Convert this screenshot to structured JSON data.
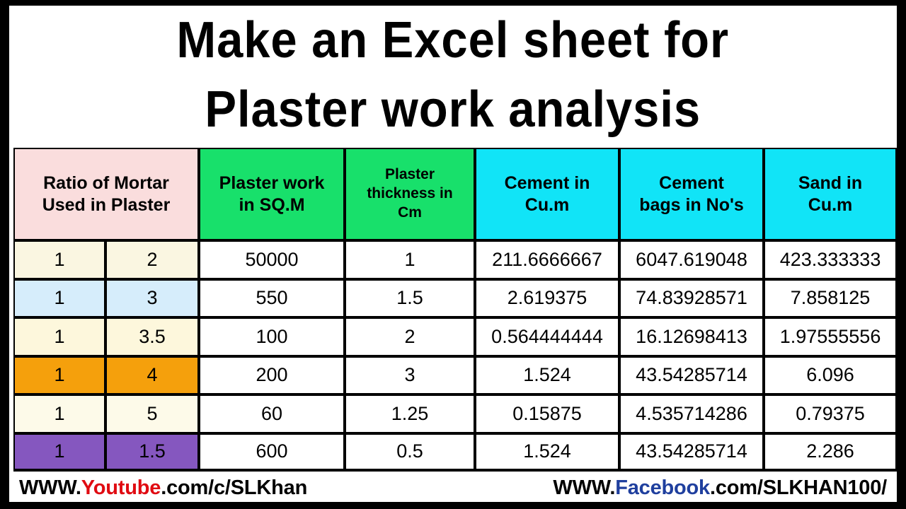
{
  "title": {
    "line1": "Make an Excel sheet for",
    "line2": "Plaster work analysis"
  },
  "table": {
    "headers": {
      "ratio": {
        "line1": "Ratio of Mortar",
        "line2": "Used in Plaster"
      },
      "plaster_work": {
        "line1": "Plaster work",
        "line2": "in SQ.M"
      },
      "thickness": {
        "line1": "Plaster",
        "line2": "thickness in",
        "line3": "Cm"
      },
      "cement_cum": {
        "line1": "Cement in",
        "line2": "Cu.m"
      },
      "cement_bags": {
        "line1": "Cement",
        "line2": "bags in No's"
      },
      "sand_cum": {
        "line1": "Sand in",
        "line2": "Cu.m"
      }
    },
    "row_colors": [
      "#faf6e1",
      "#d6edfb",
      "#fdf7dc",
      "#f5a00c",
      "#fdfae9",
      "#8557bf"
    ],
    "rows": [
      {
        "ratio_a": "1",
        "ratio_b": "2",
        "plaster_work": "50000",
        "thickness": "1",
        "cement_cum": "211.6666667",
        "cement_bags": "6047.619048",
        "sand_cum": "423.333333"
      },
      {
        "ratio_a": "1",
        "ratio_b": "3",
        "plaster_work": "550",
        "thickness": "1.5",
        "cement_cum": "2.619375",
        "cement_bags": "74.83928571",
        "sand_cum": "7.858125"
      },
      {
        "ratio_a": "1",
        "ratio_b": "3.5",
        "plaster_work": "100",
        "thickness": "2",
        "cement_cum": "0.564444444",
        "cement_bags": "16.12698413",
        "sand_cum": "1.97555556"
      },
      {
        "ratio_a": "1",
        "ratio_b": "4",
        "plaster_work": "200",
        "thickness": "3",
        "cement_cum": "1.524",
        "cement_bags": "43.54285714",
        "sand_cum": "6.096"
      },
      {
        "ratio_a": "1",
        "ratio_b": "5",
        "plaster_work": "60",
        "thickness": "1.25",
        "cement_cum": "0.15875",
        "cement_bags": "4.535714286",
        "sand_cum": "0.79375"
      },
      {
        "ratio_a": "1",
        "ratio_b": "1.5",
        "plaster_work": "600",
        "thickness": "0.5",
        "cement_cum": "1.524",
        "cement_bags": "43.54285714",
        "sand_cum": "2.286"
      }
    ]
  },
  "footer": {
    "youtube": {
      "prefix": "WWW.",
      "brand": "Youtube",
      "suffix": ".com/c/SLKhan"
    },
    "facebook": {
      "prefix": "WWW.",
      "brand": "Facebook",
      "suffix": ".com/SLKHAN100/"
    }
  },
  "colors": {
    "header_ratio": "#fadddd",
    "header_green": "#18e06b",
    "header_cyan": "#11e4f7",
    "youtube_red": "#e00b12",
    "facebook_blue": "#1f3f9e",
    "frame_black": "#000000"
  }
}
